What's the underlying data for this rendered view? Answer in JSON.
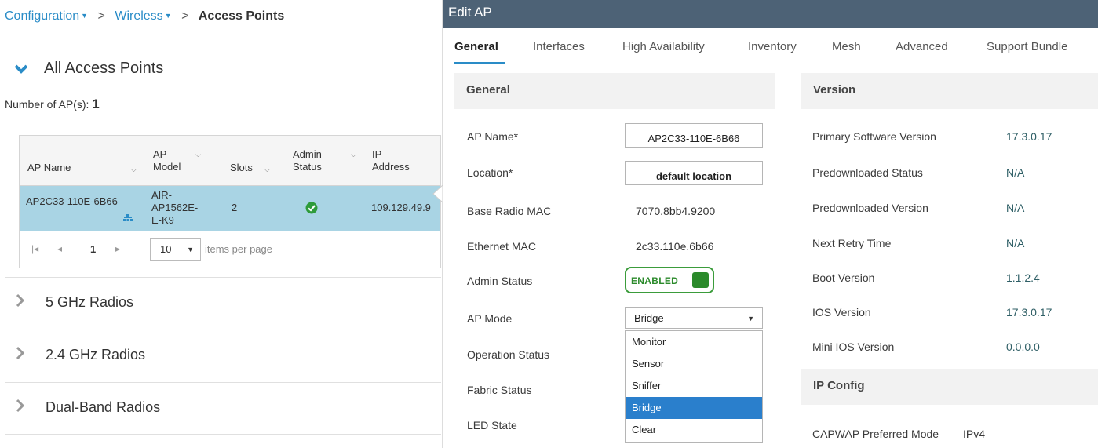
{
  "breadcrumb": {
    "items": [
      "Configuration",
      "Wireless"
    ],
    "current": "Access Points"
  },
  "all_aps": {
    "title": "All Access Points",
    "count_label": "Number of AP(s):",
    "count_value": "1"
  },
  "ap_table": {
    "columns": [
      {
        "line1": "AP Name",
        "line2": ""
      },
      {
        "line1": "AP",
        "line2": "Model"
      },
      {
        "line1": "Slots",
        "line2": ""
      },
      {
        "line1": "Admin",
        "line2": "Status"
      },
      {
        "line1": "IP",
        "line2": "Address"
      }
    ],
    "row": {
      "ap_name": "AP2C33-110E-6B66",
      "model_l1": "AIR-",
      "model_l2": "AP1562E-",
      "model_l3": "E-K9",
      "slots": "2",
      "ip": "109.129.49.9"
    },
    "pager": {
      "page": "1",
      "page_size": "10",
      "label": "items per page"
    }
  },
  "sections": [
    {
      "label": "5 GHz Radios"
    },
    {
      "label": "2.4 GHz Radios"
    },
    {
      "label": "Dual-Band Radios"
    }
  ],
  "modal": {
    "title": "Edit AP",
    "tabs": [
      "General",
      "Interfaces",
      "High Availability",
      "Inventory",
      "Mesh",
      "Advanced",
      "Support Bundle"
    ],
    "active_tab": "General",
    "general": {
      "header": "General",
      "ap_name_label": "AP Name*",
      "ap_name_value": "AP2C33-110E-6B66",
      "location_label": "Location*",
      "location_value": "default location",
      "base_mac_label": "Base Radio MAC",
      "base_mac_value": "7070.8bb4.9200",
      "eth_mac_label": "Ethernet MAC",
      "eth_mac_value": "2c33.110e.6b66",
      "admin_status_label": "Admin Status",
      "admin_status_value": "ENABLED",
      "ap_mode_label": "AP Mode",
      "ap_mode_value": "Bridge",
      "ap_mode_options": [
        "Monitor",
        "Sensor",
        "Sniffer",
        "Bridge",
        "Clear"
      ],
      "op_status_label": "Operation Status",
      "fabric_status_label": "Fabric Status",
      "led_state_label": "LED State"
    },
    "version": {
      "header": "Version",
      "rows": [
        {
          "label": "Primary Software Version",
          "value": "17.3.0.17"
        },
        {
          "label": "Predownloaded Status",
          "value": "N/A"
        },
        {
          "label": "Predownloaded Version",
          "value": "N/A"
        },
        {
          "label": "Next Retry Time",
          "value": "N/A"
        },
        {
          "label": "Boot Version",
          "value": "1.1.2.4"
        },
        {
          "label": "IOS Version",
          "value": "17.3.0.17"
        },
        {
          "label": "Mini IOS Version",
          "value": "0.0.0.0"
        }
      ]
    },
    "ip_config": {
      "header": "IP Config",
      "capwap_label": "CAPWAP Preferred Mode",
      "capwap_value": "IPv4"
    }
  },
  "colors": {
    "link_blue": "#2a8cc7",
    "selected_row": "#a9d4e4",
    "title_bar": "#4d6276",
    "enabled_green": "#2b8a2b",
    "dropdown_highlight": "#2a7fcc"
  },
  "icons": [
    "chevron-down-icon",
    "chevron-right-icon",
    "check-circle-icon",
    "network-tree-icon",
    "caret-down-icon",
    "pager-first-icon",
    "pager-prev-icon",
    "pager-next-icon"
  ]
}
